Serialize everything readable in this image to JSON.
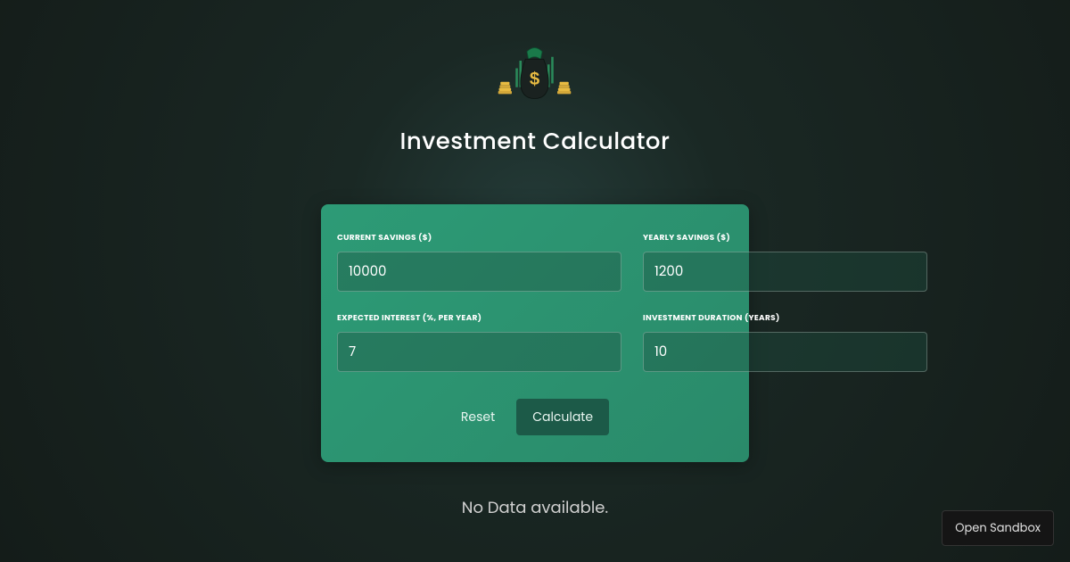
{
  "header": {
    "title": "Investment Calculator"
  },
  "form": {
    "current_savings": {
      "label": "CURRENT SAVINGS ($)",
      "value": "10000"
    },
    "yearly_savings": {
      "label": "YEARLY SAVINGS ($)",
      "value": "1200"
    },
    "expected_interest": {
      "label": "EXPECTED INTEREST (%, PER YEAR)",
      "value": "7"
    },
    "investment_duration": {
      "label": "INVESTMENT DURATION (YEARS)",
      "value": "10"
    }
  },
  "buttons": {
    "reset": "Reset",
    "calculate": "Calculate"
  },
  "status": {
    "no_data": "No Data available."
  },
  "footer": {
    "open_sandbox": "Open Sandbox"
  }
}
